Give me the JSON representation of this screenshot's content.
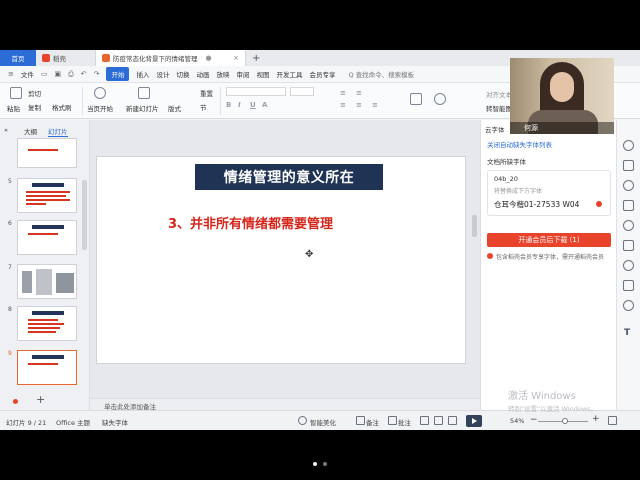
{
  "tabs": {
    "home": "首页",
    "docer": "稻壳",
    "document": "防疫常态化背景下的情绪管理"
  },
  "menu": {
    "file": "文件",
    "items": [
      "开始",
      "插入",
      "设计",
      "切换",
      "动画",
      "放映",
      "审阅",
      "视图",
      "开发工具",
      "会员专享"
    ],
    "search": "Q 查找命令、搜索模板"
  },
  "ribbon": {
    "cut": "剪切",
    "paste": "粘贴",
    "copy": "复制",
    "format_painter": "格式刷",
    "from_current": "当页开始",
    "new_slide": "新建幻灯片",
    "layout": "版式",
    "reset": "重置",
    "section": "节",
    "right_texts": [
      "对齐文本",
      "转智能图"
    ]
  },
  "left_panel": {
    "tabs": [
      "大纲",
      "幻灯片"
    ],
    "slide_numbers": [
      "5",
      "6",
      "7",
      "8",
      "9"
    ]
  },
  "slide": {
    "title": "情绪管理的意义所在",
    "subtitle": "3、并非所有情绪都需要管理"
  },
  "notes_placeholder": "单击此处添加备注",
  "right_panel": {
    "cloud_font": "云字体",
    "close_auto": "关闭自动缺失字体列表",
    "missing_fonts": "文档所缺字体",
    "font_code": "04b_20",
    "replace_hint": "将替换成下方字体",
    "font_name": "仓耳今楷01-27533 W04",
    "download_btn": "开通会员后下载 (1)",
    "member_note": "包含稻壳会员专享字体，需开通稻壳会员"
  },
  "status": {
    "slide_info": "幻灯片 9 / 21",
    "theme": "Office 主题",
    "missing_font": "缺失字体",
    "smart_beautify": "智能美化",
    "notes": "备注",
    "comments": "批注",
    "zoom": "54%"
  },
  "watermark": {
    "line1": "激活 Windows",
    "line2": "转到\"设置\"以激活 Windows。"
  },
  "webcam": {
    "name": "何源"
  },
  "colors": {
    "accent_blue": "#2b6cd6",
    "title_navy": "#1f3355",
    "subtitle_red": "#d6261b",
    "download_red": "#e8442c"
  }
}
